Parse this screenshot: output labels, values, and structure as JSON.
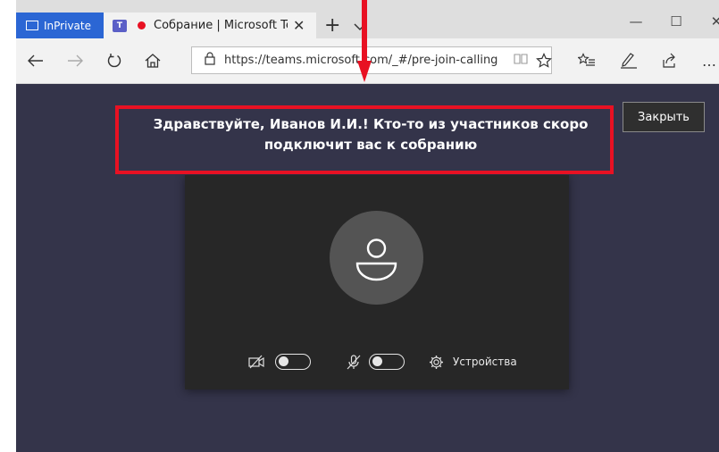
{
  "browser": {
    "inprivate_label": "InPrivate",
    "tab_title": "Собрание | Microsoft Teams",
    "tab_close": "✕",
    "new_tab": "+",
    "tab_list": "⌄",
    "window_controls": {
      "minimize": "—",
      "maximize": "☐",
      "close": "✕"
    },
    "address_url": "https://teams.microsoft.com/_#/pre-join-calling",
    "icons": [
      "back-icon",
      "forward-icon",
      "refresh-icon",
      "home-icon",
      "lock-icon",
      "reader-view-icon",
      "favorite-star-icon",
      "favorites-list-icon",
      "pen-icon",
      "share-icon",
      "more-icon"
    ],
    "more": "…"
  },
  "page": {
    "background_color": "#34344a",
    "banner_text": "Здравствуйте, Иванов И.И.! Кто-то из участников скоро подключит вас к собранию",
    "close_button": "Закрыть",
    "controls": {
      "devices_label": "Устройства"
    },
    "highlight_color": "#e81123"
  }
}
